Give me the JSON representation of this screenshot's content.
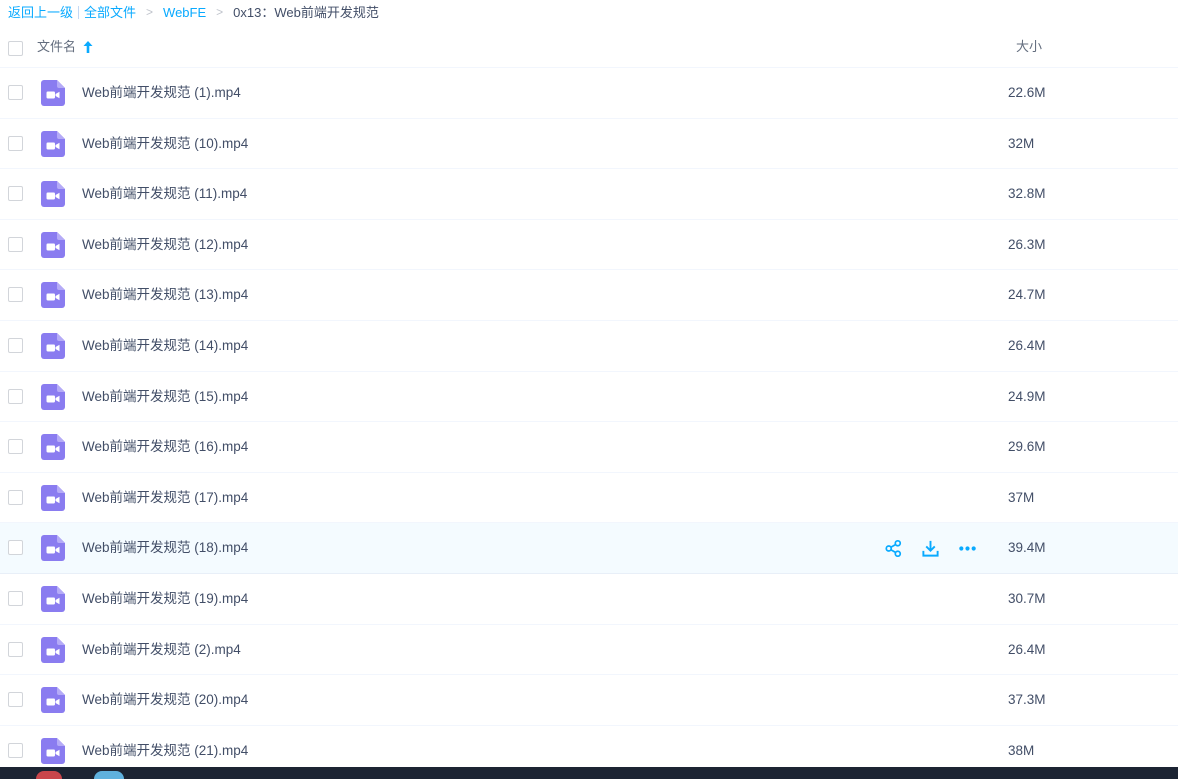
{
  "breadcrumb": {
    "back": "返回上一级",
    "all_files": "全部文件",
    "folder": "WebFE",
    "current": "0x13：Web前端开发规范"
  },
  "header": {
    "name_label": "文件名",
    "size_label": "大小"
  },
  "colors": {
    "accent": "#09aaff",
    "video_icon": "#8a7cf0",
    "hover_row": "#f4fbff"
  },
  "files": [
    {
      "name": "Web前端开发规范 (1).mp4",
      "size": "22.6M"
    },
    {
      "name": "Web前端开发规范 (10).mp4",
      "size": "32M"
    },
    {
      "name": "Web前端开发规范 (11).mp4",
      "size": "32.8M"
    },
    {
      "name": "Web前端开发规范 (12).mp4",
      "size": "26.3M"
    },
    {
      "name": "Web前端开发规范 (13).mp4",
      "size": "24.7M"
    },
    {
      "name": "Web前端开发规范 (14).mp4",
      "size": "26.4M"
    },
    {
      "name": "Web前端开发规范 (15).mp4",
      "size": "24.9M"
    },
    {
      "name": "Web前端开发规范 (16).mp4",
      "size": "29.6M"
    },
    {
      "name": "Web前端开发规范 (17).mp4",
      "size": "37M"
    },
    {
      "name": "Web前端开发规范 (18).mp4",
      "size": "39.4M"
    },
    {
      "name": "Web前端开发规范 (19).mp4",
      "size": "30.7M"
    },
    {
      "name": "Web前端开发规范 (2).mp4",
      "size": "26.4M"
    },
    {
      "name": "Web前端开发规范 (20).mp4",
      "size": "37.3M"
    },
    {
      "name": "Web前端开发规范 (21).mp4",
      "size": "38M"
    }
  ],
  "hovered_index": 9,
  "row_actions": [
    "share-icon",
    "download-icon",
    "more-icon"
  ]
}
